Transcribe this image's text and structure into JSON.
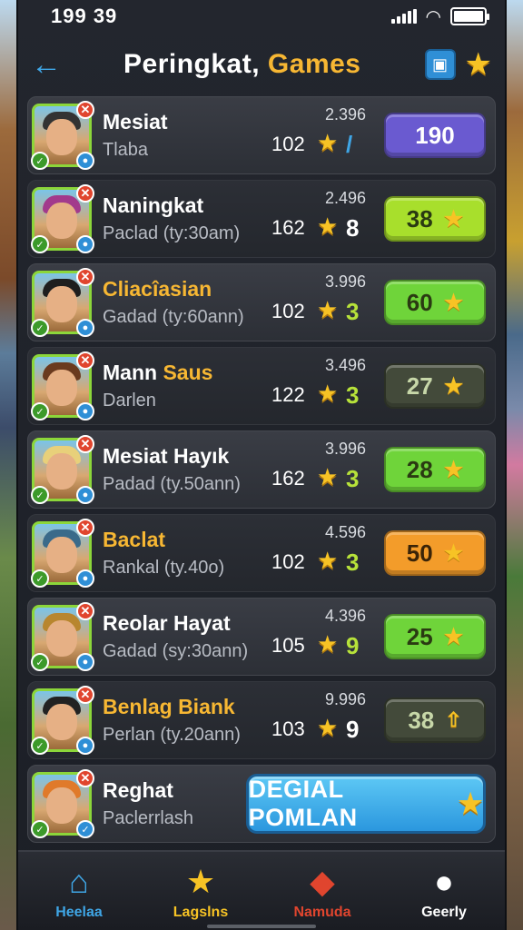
{
  "status": {
    "time": "199 39"
  },
  "header": {
    "title_main": "Peringkat,",
    "title_accent": "Games"
  },
  "rows": [
    {
      "name": "Mesiat",
      "sub": "Tlaba",
      "rank": "102",
      "score": "2.396",
      "mid_mark": "/",
      "pill": "190",
      "pill_style": "purple",
      "pill_star": false,
      "hair": "#333333",
      "name_gold": false
    },
    {
      "name": "Naningkat",
      "sub": "Paclad (ty:30am)",
      "rank": "162",
      "score": "2.496",
      "mid_mark": "8",
      "pill": "38",
      "pill_style": "lime",
      "pill_star": true,
      "hair": "#a23a8c",
      "name_gold": false
    },
    {
      "name": "Cliacîasian",
      "sub": "Gadad (ty:60ann)",
      "rank": "102",
      "score": "3.996",
      "mid_mark": "3",
      "pill": "60",
      "pill_style": "green",
      "pill_star": true,
      "hair": "#1e1e1e",
      "name_gold": true
    },
    {
      "name_part1": "Mann",
      "name_part2": "Saus",
      "sub": "Darlen",
      "rank": "122",
      "score": "3.496",
      "mid_mark": "3",
      "pill": "27",
      "pill_style": "dark",
      "pill_star": true,
      "hair": "#6a3a1e",
      "name_gold": false
    },
    {
      "name": "Mesiat Hayık",
      "sub": "Padad (ty.50ann)",
      "rank": "162",
      "score": "3.996",
      "mid_mark": "3",
      "pill": "28",
      "pill_style": "green",
      "pill_star": true,
      "hair": "#e8d07a",
      "name_gold": false
    },
    {
      "name": "Baclat",
      "sub": "Rankal (ty.40o)",
      "rank": "102",
      "score": "4.596",
      "mid_mark": "3",
      "pill": "50",
      "pill_style": "orange",
      "pill_star": true,
      "hair": "#3a6a8a",
      "name_gold": true
    },
    {
      "name": "Reolar Hayat",
      "sub": "Gadad (sy:30ann)",
      "rank": "105",
      "score": "4.396",
      "mid_mark": "9",
      "pill": "25",
      "pill_style": "green",
      "pill_star": true,
      "hair": "#b8862e",
      "name_gold": false
    },
    {
      "name": "Benlag Biank",
      "sub": "Perlan (ty.20ann)",
      "rank": "103",
      "score": "9.996",
      "mid_mark": "9",
      "pill": "38",
      "pill_style": "dark",
      "pill_star": false,
      "hair": "#222222",
      "name_gold": true
    }
  ],
  "last_row": {
    "name": "Reghat",
    "sub": "Paclerrlash",
    "cta": "DEGIAL POMLAN"
  },
  "nav": [
    {
      "label": "Heelaa",
      "icon": "home-icon",
      "color": "#3fa6e6"
    },
    {
      "label": "Lagslns",
      "icon": "star-icon",
      "color": "#f7c325"
    },
    {
      "label": "Namuda",
      "icon": "tag-icon",
      "color": "#e0452e"
    },
    {
      "label": "Geerly",
      "icon": "person-icon",
      "color": "#ffffff"
    }
  ],
  "colors": {
    "accent": "#f7b733",
    "blue": "#3fa6e6",
    "star": "#f7c325"
  }
}
